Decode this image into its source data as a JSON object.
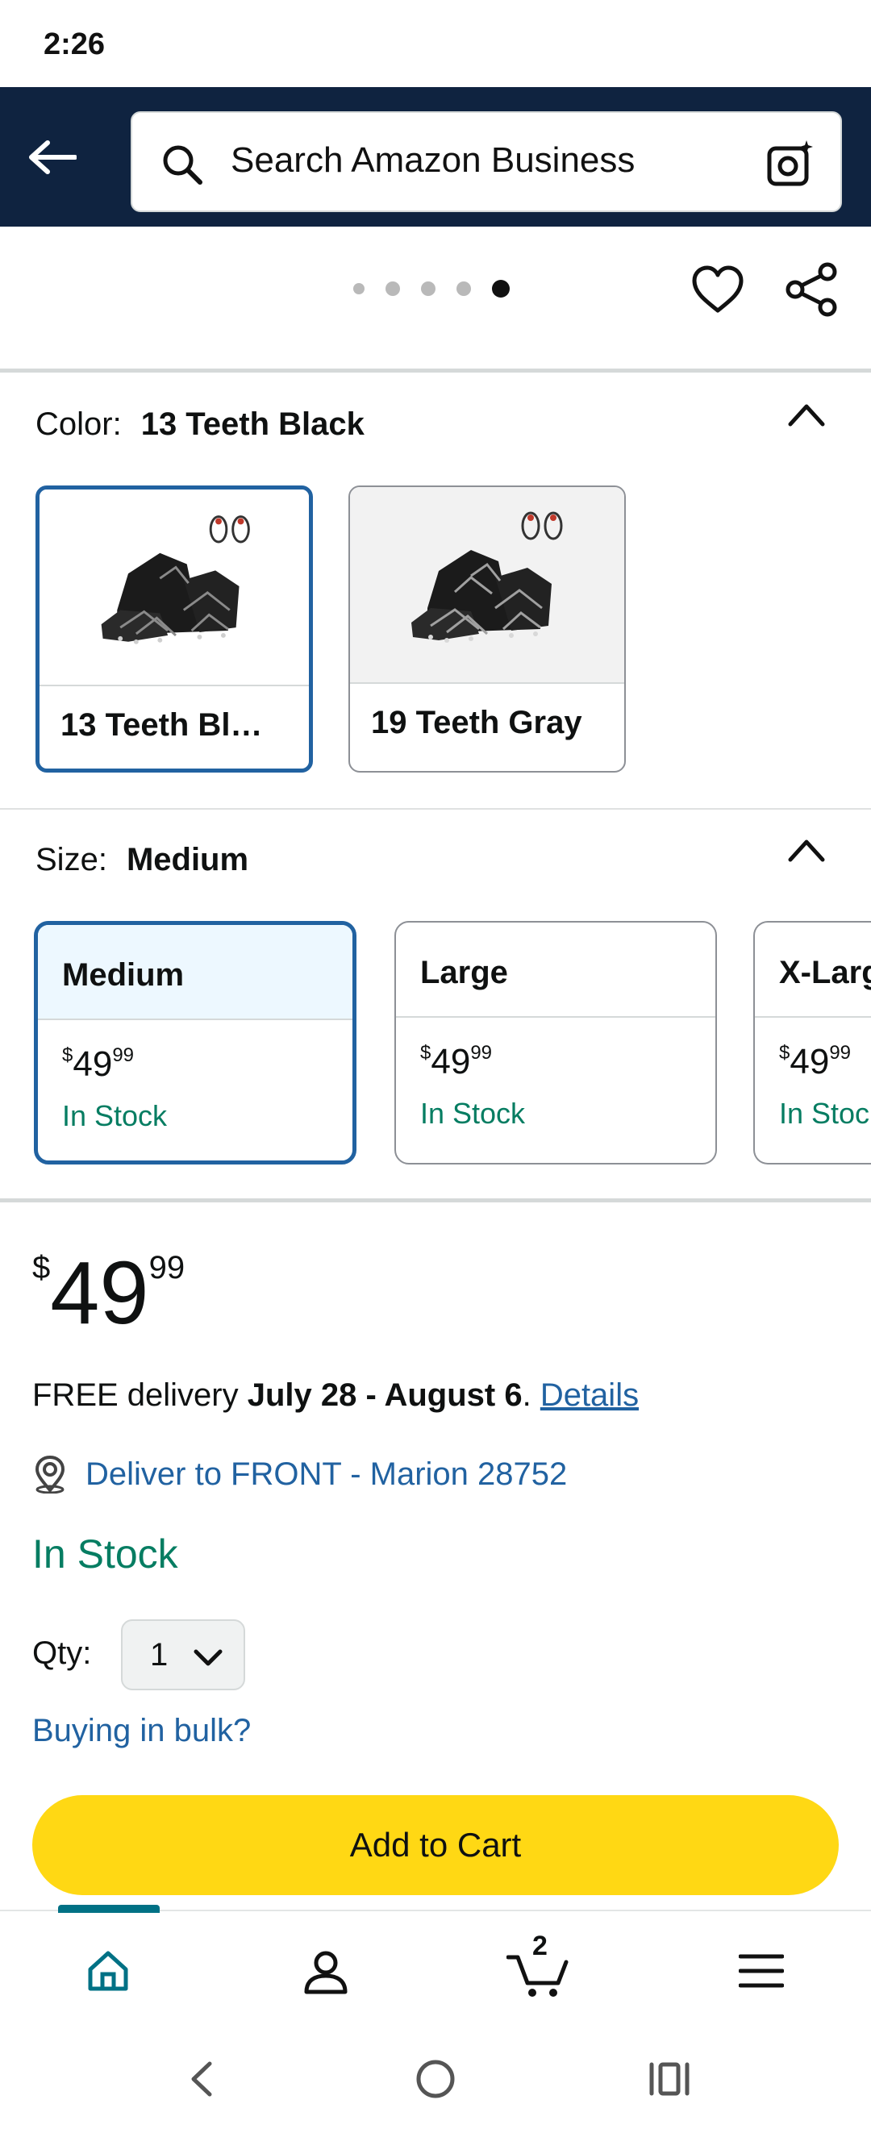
{
  "status_bar": {
    "time": "2:26"
  },
  "header": {
    "search_placeholder": "Search Amazon Business"
  },
  "carousel": {
    "dot_count": 5,
    "active_index": 4
  },
  "color": {
    "label": "Color:",
    "selected_value": "13 Teeth Black",
    "options": [
      {
        "name": "13 Teeth Bl…",
        "selected": true
      },
      {
        "name": "19 Teeth Gray",
        "selected": false
      }
    ]
  },
  "size": {
    "label": "Size:",
    "selected_value": "Medium",
    "options": [
      {
        "name": "Medium",
        "price_currency": "$",
        "price_whole": "49",
        "price_fraction": "99",
        "stock": "In Stock",
        "selected": true
      },
      {
        "name": "Large",
        "price_currency": "$",
        "price_whole": "49",
        "price_fraction": "99",
        "stock": "In Stock",
        "selected": false
      },
      {
        "name": "X-Large",
        "price_currency": "$",
        "price_whole": "49",
        "price_fraction": "99",
        "stock": "In Stock",
        "selected": false
      }
    ]
  },
  "buybox": {
    "price_currency": "$",
    "price_whole": "49",
    "price_fraction": "99",
    "delivery_prefix": "FREE delivery ",
    "delivery_dates": "July 28 - August 6",
    "delivery_suffix": ". ",
    "details_link": "Details",
    "location": "Deliver to FRONT - Marion 28752",
    "availability": "In Stock",
    "qty_label": "Qty:",
    "qty_value": "1",
    "bulk_link": "Buying in bulk?",
    "add_to_cart": "Add to Cart"
  },
  "bottom_nav": {
    "items": [
      "home-icon",
      "account-icon",
      "cart-icon",
      "menu-icon"
    ],
    "cart_count": "2",
    "active_item": "home"
  },
  "colors": {
    "header_bg": "#0f2340",
    "link": "#2162a1",
    "in_stock": "#067d62",
    "selected_border": "#2162a1",
    "add_to_cart": "#ffd814",
    "nav_indicator": "#007185"
  }
}
